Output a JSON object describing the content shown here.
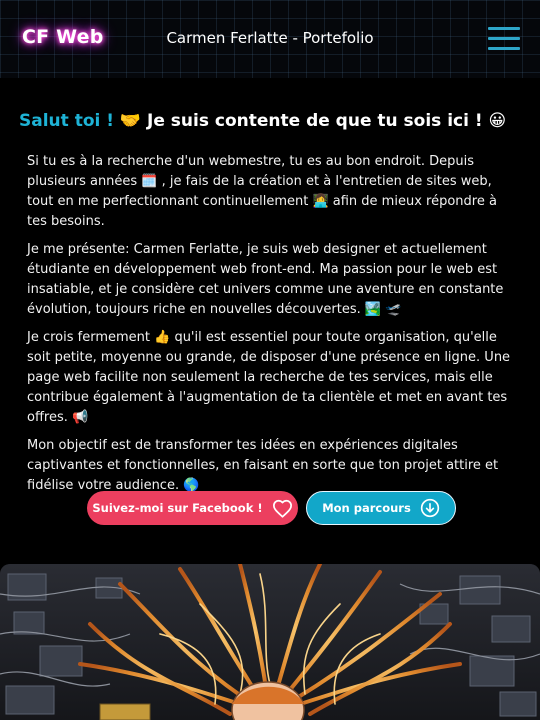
{
  "header": {
    "logo_text": "CF Web",
    "title": "Carmen Ferlatte - Portefolio",
    "menu_icon": "hamburger-menu-icon"
  },
  "intro": {
    "greeting_highlight": "Salut toi !",
    "greeting_emoji_1": "🤝",
    "greeting_text": "Je suis contente de que tu sois ici !",
    "greeting_emoji_2": "😀",
    "paragraphs": [
      "Si tu es à la recherche d'un webmestre, tu es au bon endroit. Depuis plusieurs années 🗓️ , je fais de la création et à l'entretien de sites web, tout en me perfectionnant continuellement 👩‍💻 afin de mieux répondre à tes besoins.",
      "Je me présente: Carmen Ferlatte, je suis web designer et actuellement étudiante en développement web front-end. Ma passion pour le web est insatiable, et je considère cet univers comme une aventure en constante évolution, toujours riche en nouvelles découvertes. 🏞️ 🛫",
      "Je crois fermement 👍 qu'il est essentiel pour toute organisation, qu'elle soit petite, moyenne ou grande, de disposer d'une présence en ligne. Une page web facilite non seulement la recherche de tes services, mais elle contribue également à l'augmentation de ta clientèle et met en avant tes offres. 📢",
      "Mon objectif est de transformer tes idées en expériences digitales captivantes et fonctionnelles, en faisant en sorte que ton projet attire et fidélise votre audience. 🌎"
    ]
  },
  "actions": {
    "facebook_label": "Suivez-moi sur Facebook !",
    "facebook_icon": "heart-icon",
    "parcours_label": "Mon parcours",
    "parcours_icon": "arrow-down-circle-icon"
  },
  "colors": {
    "accent_cyan": "#1eb3d6",
    "facebook_pink": "#ec3f5f",
    "menu_cyan": "#2ea6c9",
    "logo_glow": "#ff3fd8"
  }
}
